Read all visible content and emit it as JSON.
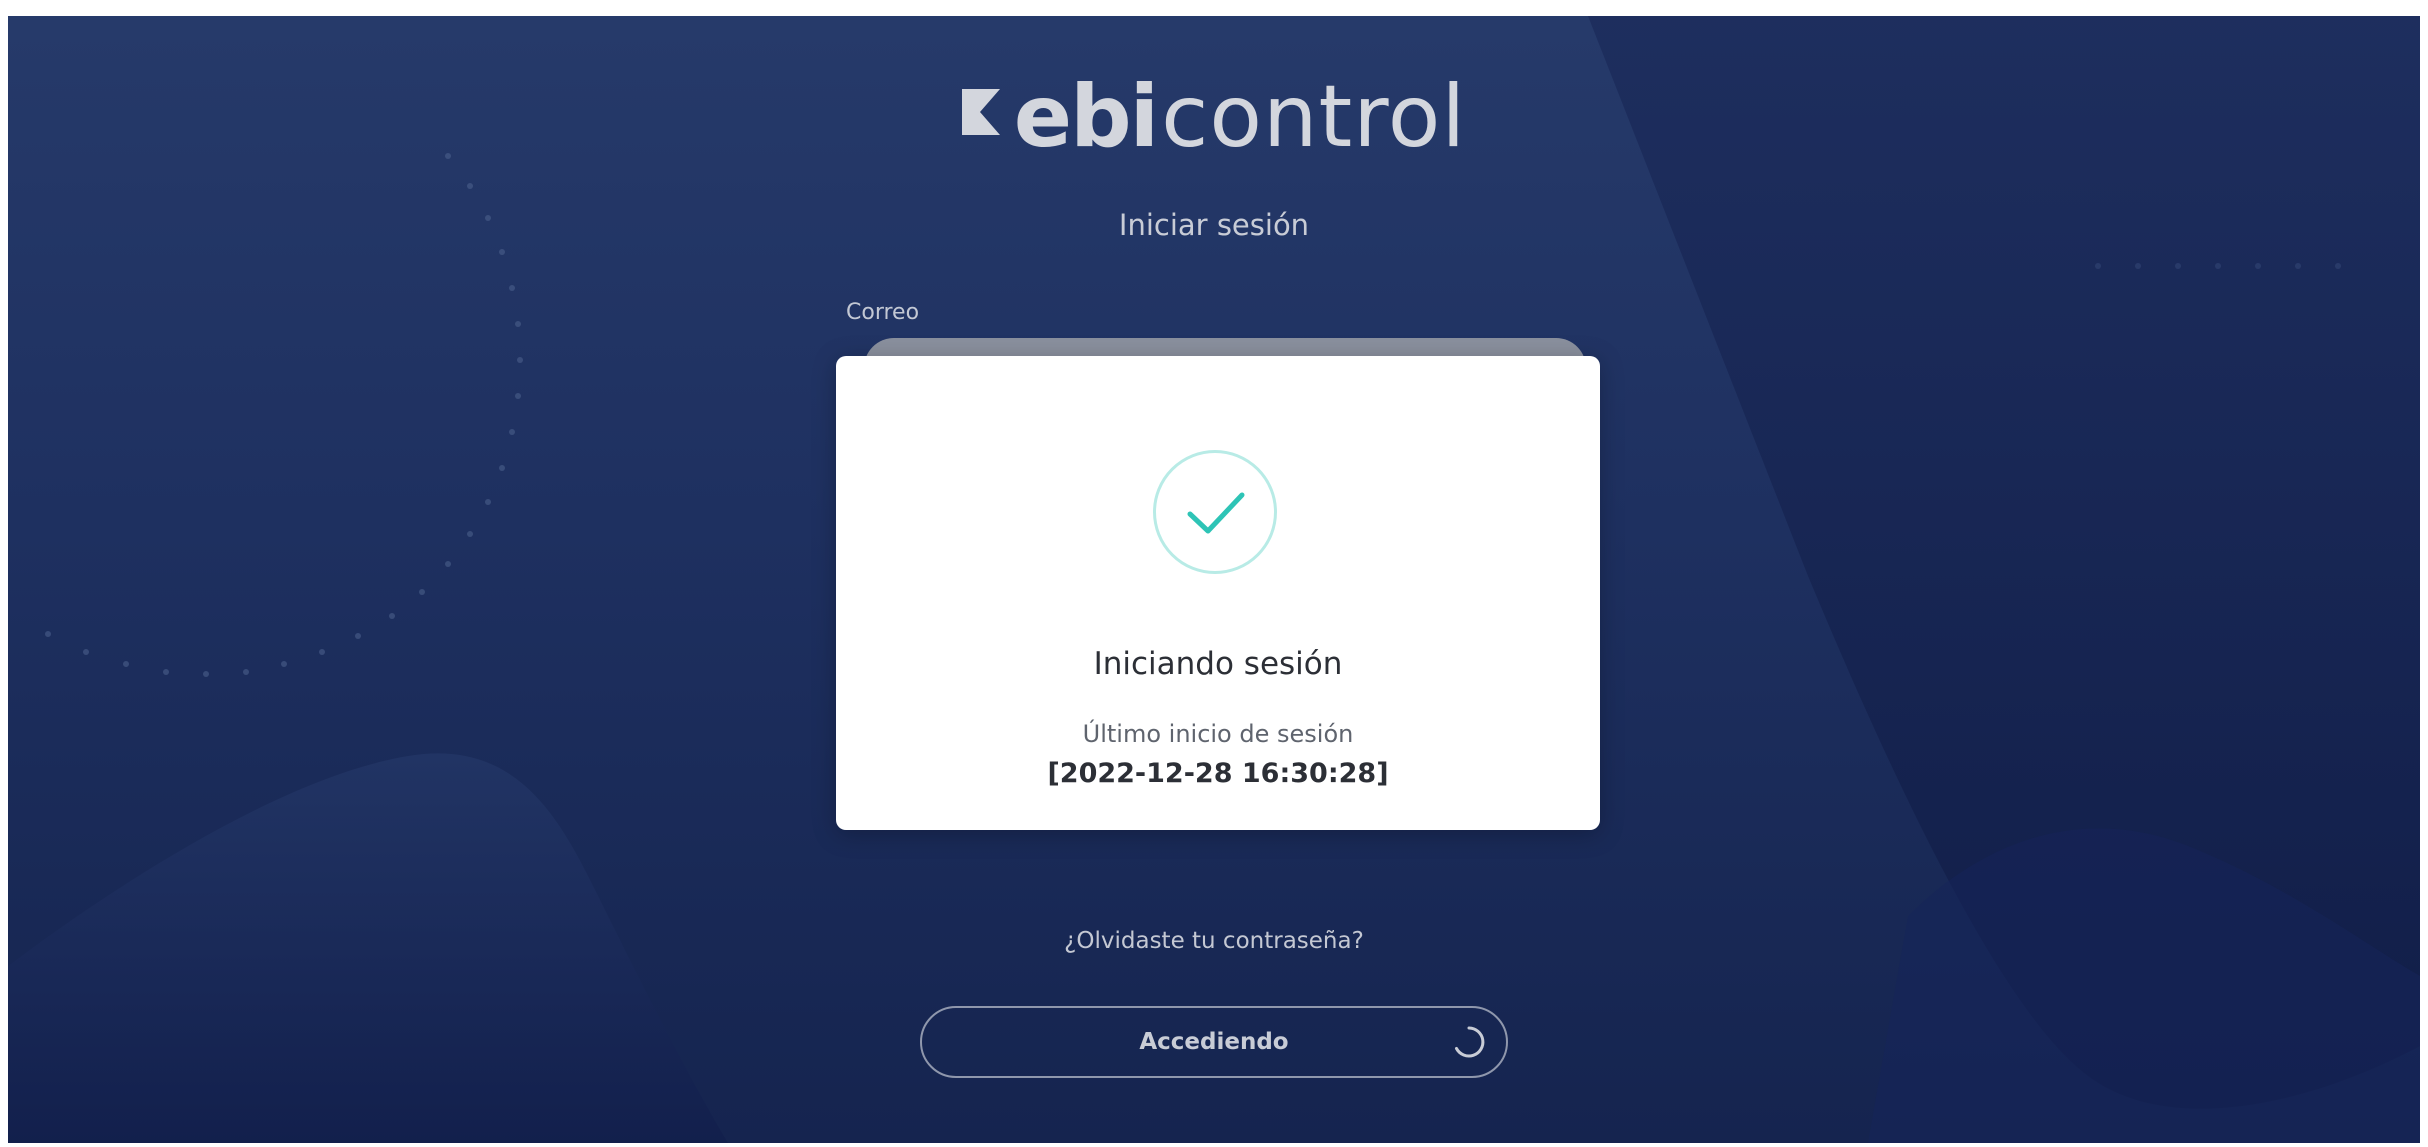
{
  "app": {
    "logo_bold": "ebi",
    "logo_light": "control",
    "page_title": "Iniciar sesión"
  },
  "form": {
    "email_label": "Correo",
    "forgot_password": "¿Olvidaste tu contraseña?",
    "submit_label": "Accediendo"
  },
  "modal": {
    "title": "Iniciando sesión",
    "subtitle": "Último inicio de sesión",
    "timestamp": "[2022-12-28 16:30:28]",
    "icon": "checkmark-icon",
    "accent_color": "#2ec4b6"
  },
  "colors": {
    "background": "#1e3060",
    "text_light": "#c8ccd6",
    "modal_bg": "#ffffff"
  }
}
